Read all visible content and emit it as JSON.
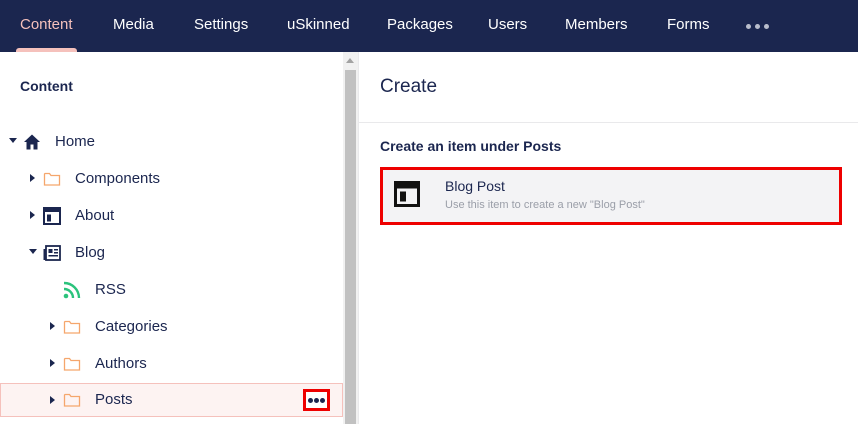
{
  "topnav": {
    "items": [
      {
        "label": "Content",
        "active": true
      },
      {
        "label": "Media"
      },
      {
        "label": "Settings"
      },
      {
        "label": "uSkinned"
      },
      {
        "label": "Packages"
      },
      {
        "label": "Users"
      },
      {
        "label": "Members"
      },
      {
        "label": "Forms"
      }
    ],
    "more_icon": "ellipsis-icon"
  },
  "tree": {
    "title": "Content",
    "items": [
      {
        "label": "Home",
        "icon": "home-icon",
        "expanded": true
      },
      {
        "label": "Components",
        "icon": "folder-icon"
      },
      {
        "label": "About",
        "icon": "layout-icon"
      },
      {
        "label": "Blog",
        "icon": "newspaper-icon",
        "expanded": true
      },
      {
        "label": "RSS",
        "icon": "rss-icon"
      },
      {
        "label": "Categories",
        "icon": "folder-icon"
      },
      {
        "label": "Authors",
        "icon": "folder-icon"
      },
      {
        "label": "Posts",
        "icon": "folder-icon",
        "selected": true
      }
    ]
  },
  "panel": {
    "title": "Create",
    "subtitle": "Create an item under Posts",
    "item": {
      "name": "Blog Post",
      "description": "Use this item to create a new \"Blog Post\"",
      "icon": "layout-icon"
    }
  },
  "colors": {
    "nav_bg": "#1b264f",
    "accent": "#f5c1bc",
    "folder": "#f5a66c",
    "rss": "#2bc37c",
    "highlight": "#e00000"
  }
}
